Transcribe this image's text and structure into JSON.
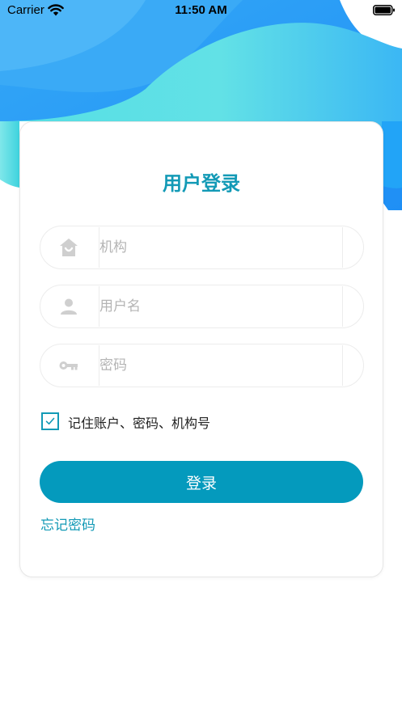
{
  "status_bar": {
    "carrier": "Carrier",
    "time": "11:50 AM"
  },
  "login": {
    "title": "用户登录",
    "institution_placeholder": "机构",
    "username_placeholder": "用户名",
    "password_placeholder": "密码",
    "remember_label": "记住账户、密码、机构号",
    "remember_checked": true,
    "login_button": "登录",
    "forgot_password": "忘记密码"
  },
  "icons": {
    "institution": "home-icon",
    "username": "person-icon",
    "password": "key-icon",
    "checkbox": "checkmark-icon"
  },
  "colors": {
    "accent": "#139ab6",
    "button": "#049abd",
    "placeholder": "#b4b4b4",
    "icon": "#cfcfcf",
    "header_wave_light": "#5ee2e6",
    "header_wave_blue": "#2aa8ff"
  }
}
